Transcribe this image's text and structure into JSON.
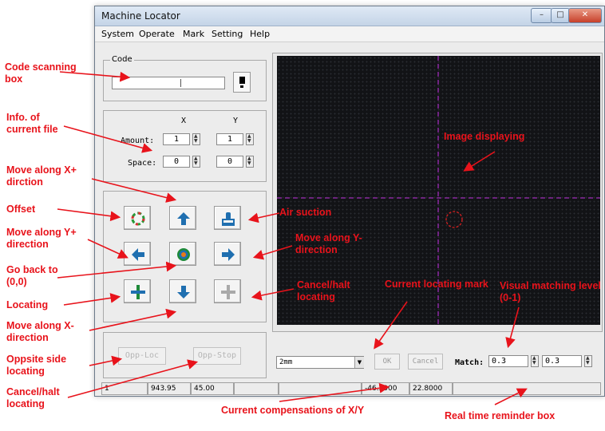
{
  "window": {
    "title": "Machine Locator",
    "minimize": "–",
    "maximize": "□",
    "close": "✕"
  },
  "menu": [
    "System",
    "Operate",
    "Mark",
    "Setting",
    "Help"
  ],
  "code_group": {
    "legend": "Code",
    "value": ""
  },
  "file_info": {
    "col_x": "X",
    "col_y": "Y",
    "amount_label": "Amount:",
    "space_label": "Space:",
    "amount_x": "1",
    "amount_y": "1",
    "space_x": "0",
    "space_y": "0"
  },
  "opp_loc_label": "Opp-Loc",
  "opp_stop_label": "Opp-Stop",
  "bottom_controls": {
    "size_value": "2mm",
    "ok_label": "OK",
    "cancel_label": "Cancel",
    "match_label": "Match:",
    "match_value_1": "0.3",
    "match_value_2": "0.3"
  },
  "status_bar": [
    "1",
    "943.95",
    "45.00",
    "",
    "",
    "-46.5000",
    "22.8000",
    ""
  ],
  "annotations": {
    "code_scanning": "Code scanning box",
    "info_current_file": "Info. of current file",
    "move_x_plus": "Move along X+ dirction",
    "offset": "Offset",
    "move_y_plus": "Move along Y+ direction",
    "go_back": "Go back to (0,0)",
    "locating": "Locating",
    "move_x_minus": "Move along X- direction",
    "opposite_side": "Oppsite side locating",
    "cancel_halt_1": "Cancel/halt locating",
    "image_displaying": "Image displaying",
    "air_suction": "Air suction",
    "move_y_minus": "Move along Y- direction",
    "cancel_halt_2": "Cancel/halt locating",
    "current_mark": "Current locating mark",
    "visual_matching": "Visual matching level (0-1)",
    "current_compensations": "Current compensations of X/Y",
    "real_time_reminder": "Real time reminder box"
  },
  "colors": {
    "annotation": "#e8131b",
    "crosshair": "#9b2bb5",
    "locating_mark": "#d42020",
    "arrow_blue": "#1f6fb0"
  }
}
